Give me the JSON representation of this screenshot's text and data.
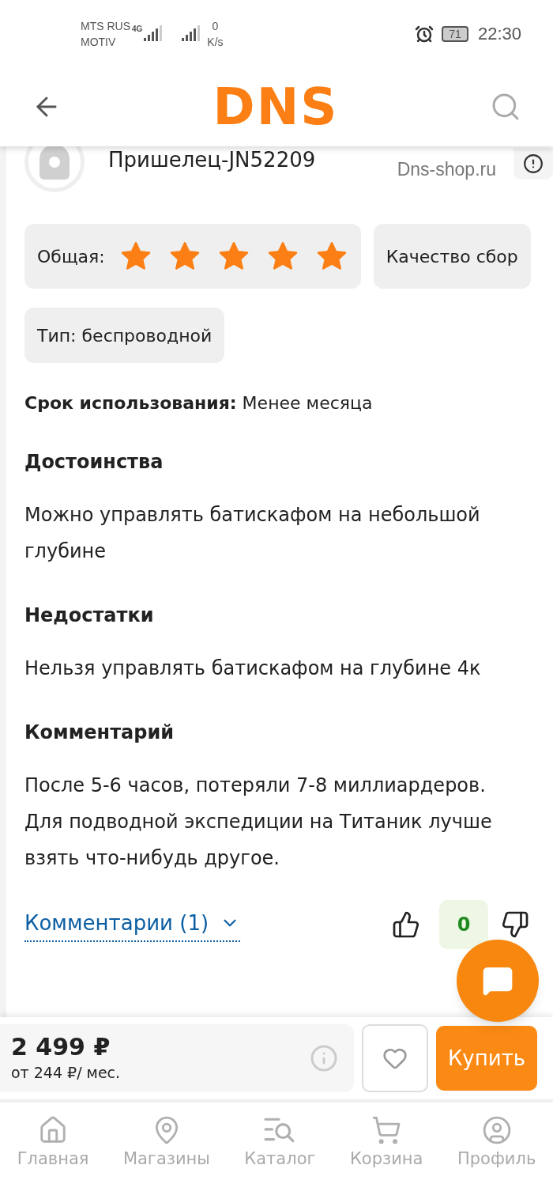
{
  "status_bar": {
    "carrier_lines": [
      "MTS RUS",
      "MOTIV"
    ],
    "network": "4G",
    "speed_lines": [
      "0",
      "K/s"
    ],
    "battery": "71",
    "time": "22:30"
  },
  "header": {
    "logo": "DNS"
  },
  "review": {
    "author": "Пришелец-JN52209",
    "source": "Dns-shop.ru",
    "ratings": [
      {
        "label": "Общая:",
        "stars": 5
      },
      {
        "label": "Качество сбор"
      }
    ],
    "tags": [
      "Тип: беспроводной"
    ],
    "usage": {
      "label": "Срок использования:",
      "value": "Менее месяца"
    },
    "sections": [
      {
        "title": "Достоинства",
        "text": "Можно управлять батискафом на небольшой глубине"
      },
      {
        "title": "Недостатки",
        "text": "Нельзя управлять батискафом на глубине 4к"
      },
      {
        "title": "Комментарий",
        "text": "После 5-6 часов, потеряли 7-8 миллиардеров. Для подводной экспедиции на Титаник лучше взять что-нибудь другое."
      }
    ],
    "comments_link": "Комментарии (1)",
    "likes": "0"
  },
  "price_bar": {
    "price": "2 499 ₽",
    "installment": "от 244 ₽/ мес.",
    "buy": "Купить"
  },
  "nav": [
    {
      "label": "Главная",
      "selected": false
    },
    {
      "label": "Магазины",
      "selected": false
    },
    {
      "label": "Каталог",
      "selected": false
    },
    {
      "label": "Корзина",
      "selected": false
    },
    {
      "label": "Профиль",
      "selected": false
    }
  ]
}
